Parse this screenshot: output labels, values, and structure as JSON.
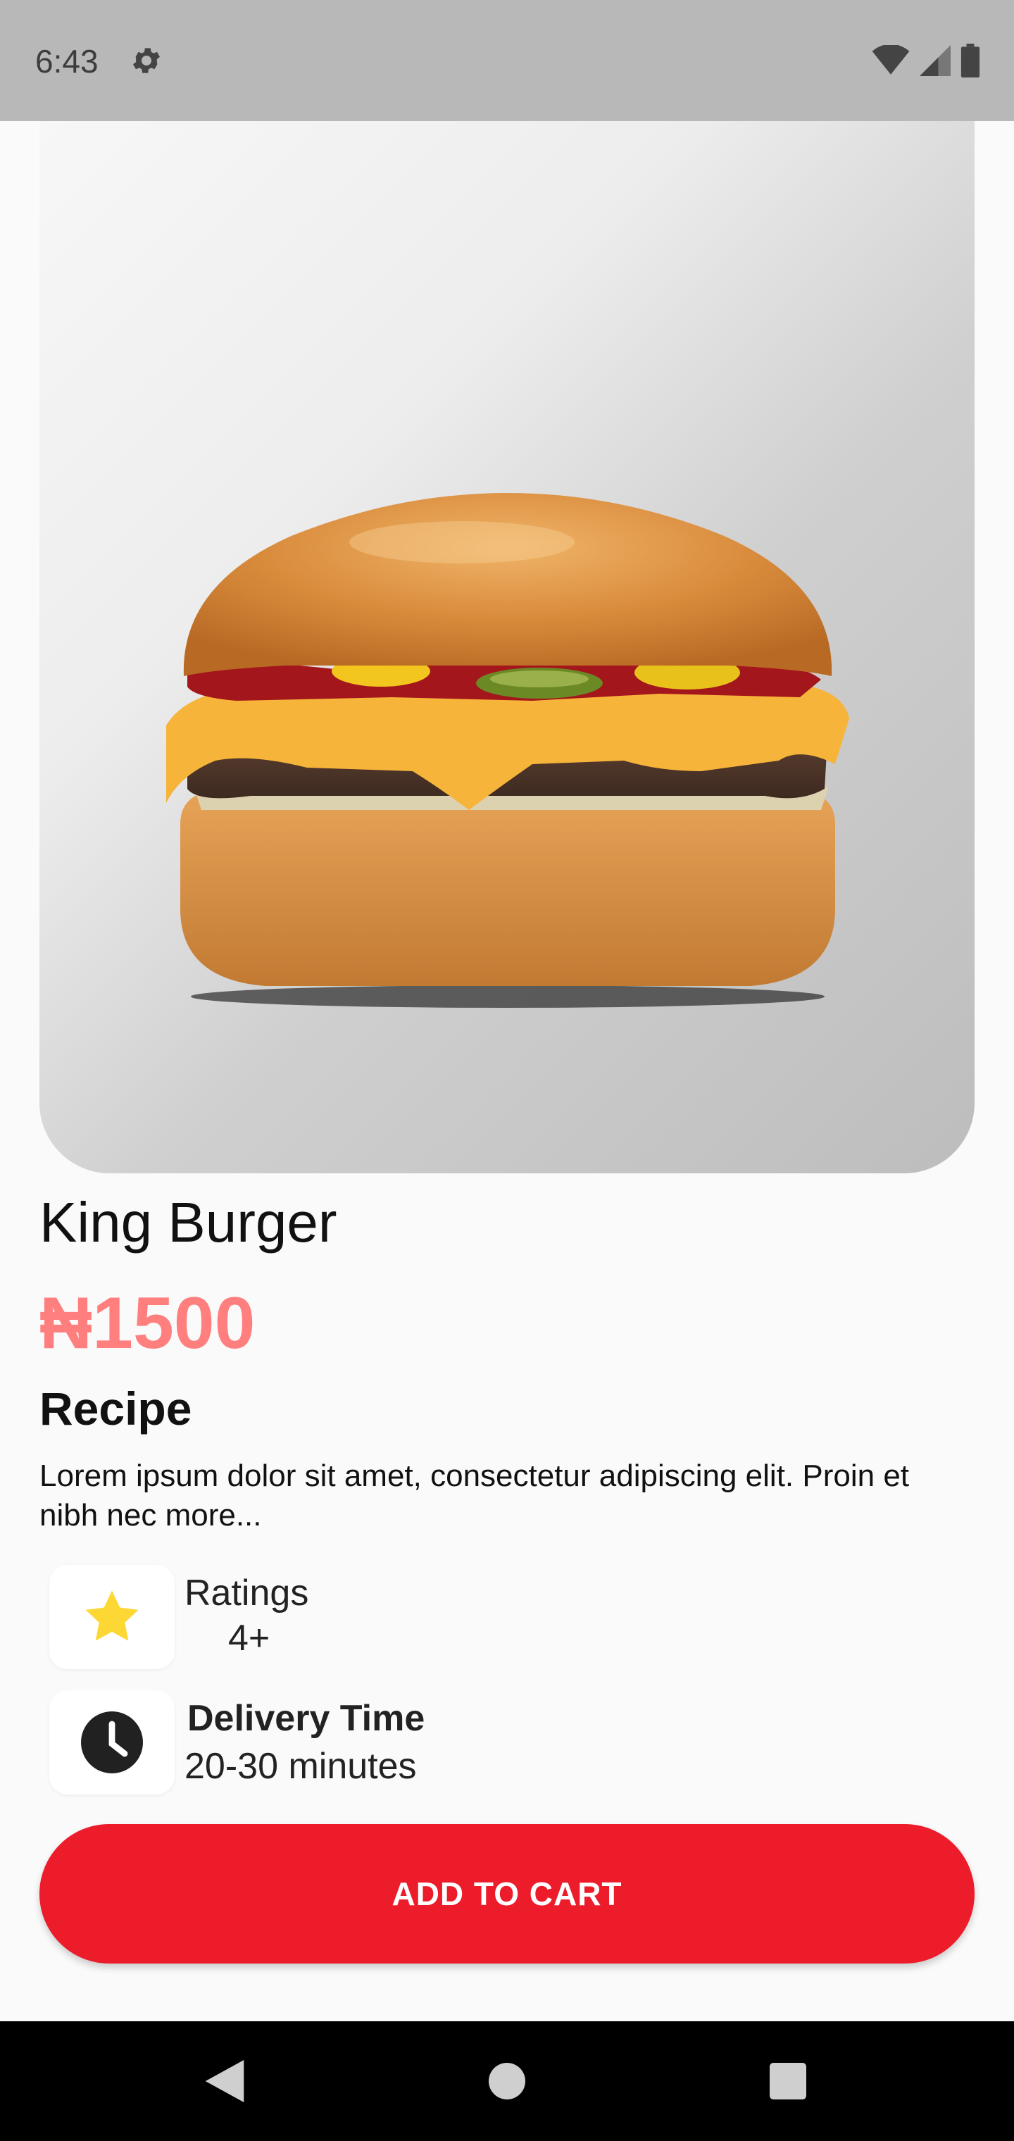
{
  "status_bar": {
    "time": "6:43",
    "icons": [
      "gear-icon",
      "wifi-icon",
      "signal-icon",
      "battery-icon"
    ]
  },
  "product": {
    "name": "King Burger",
    "price": "₦1500",
    "image": "burger-image"
  },
  "recipe": {
    "heading": "Recipe",
    "text": "Lorem ipsum dolor sit amet, consectetur adipiscing elit. Proin et nibh nec more..."
  },
  "ratings": {
    "label": "Ratings",
    "value": "4+",
    "icon": "star-icon"
  },
  "delivery": {
    "label": "Delivery Time",
    "value": "20-30 minutes",
    "icon": "clock-icon"
  },
  "cart": {
    "button_label": "ADD TO CART"
  },
  "nav": {
    "icons": [
      "back-icon",
      "home-icon",
      "recents-icon"
    ]
  },
  "colors": {
    "accent": "#ec1c2b",
    "price": "#ff7f7f",
    "star": "#fdd835",
    "background": "#fafafa"
  }
}
